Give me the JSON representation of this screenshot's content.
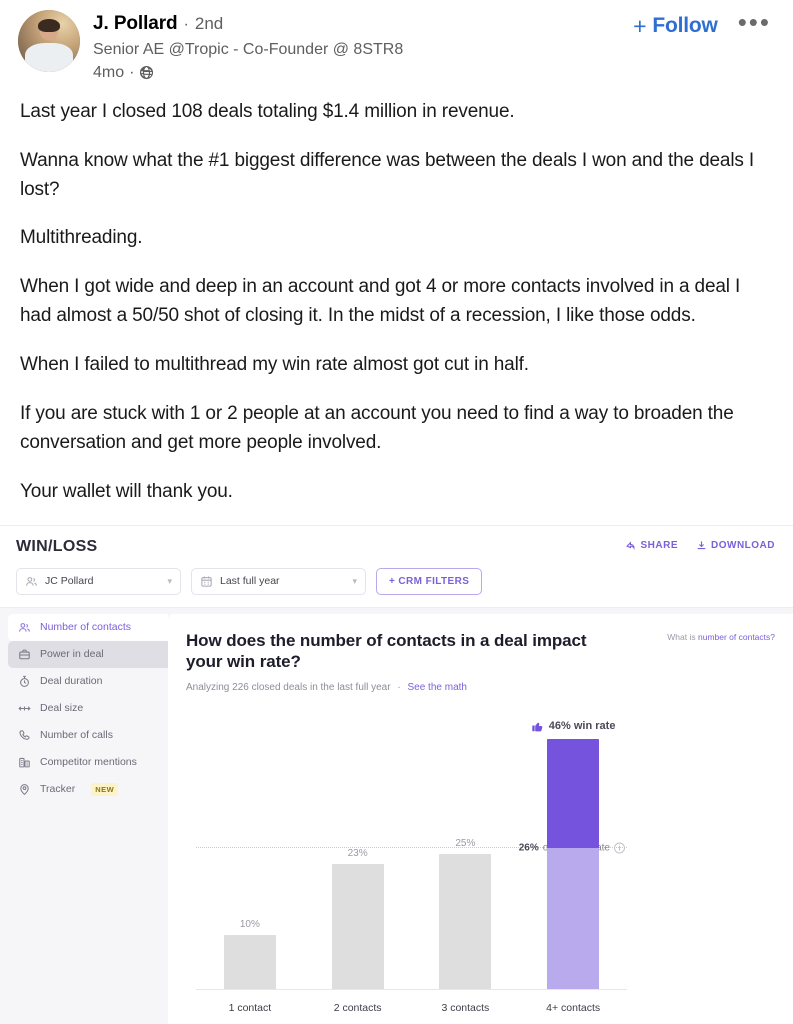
{
  "post": {
    "author_name": "J. Pollard",
    "separator": "·",
    "degree": "2nd",
    "headline": "Senior AE @Tropic - Co-Founder @ 8STR8",
    "timestamp": "4mo",
    "visibility_icon": "globe-icon",
    "follow_label": "Follow",
    "follow_plus": "+",
    "more_label": "•••",
    "paragraphs": [
      "Last year I closed 108 deals totaling $1.4 million in revenue.",
      "Wanna know what the #1 biggest difference was between the deals I won and the deals I lost?",
      "Multithreading.",
      "When I got wide and deep in an account and got 4 or more contacts involved in a deal I had almost a 50/50 shot of closing it. In the midst of a recession, I like those odds.",
      "When I failed to multithread my win rate almost got cut in half.",
      "If you are stuck with 1 or 2 people at an account you need to find a way to broaden the conversation and get more people involved.",
      "Your wallet will thank you."
    ]
  },
  "dashboard": {
    "title": "WIN/LOSS",
    "share_label": "SHARE",
    "download_label": "DOWNLOAD",
    "filters": {
      "person": "JC Pollard",
      "date_range": "Last full year",
      "crm_button": "+ CRM FILTERS"
    },
    "sidebar": {
      "items": [
        {
          "label": "Number of contacts",
          "icon": "people-icon",
          "state": "active"
        },
        {
          "label": "Power in deal",
          "icon": "briefcase-icon",
          "state": "hover"
        },
        {
          "label": "Deal duration",
          "icon": "stopwatch-icon",
          "state": "default"
        },
        {
          "label": "Deal size",
          "icon": "arrows-horizontal-icon",
          "state": "default"
        },
        {
          "label": "Number of calls",
          "icon": "phone-icon",
          "state": "default"
        },
        {
          "label": "Competitor mentions",
          "icon": "buildings-icon",
          "state": "default"
        },
        {
          "label": "Tracker",
          "icon": "location-pin-icon",
          "state": "default",
          "badge": "NEW"
        }
      ]
    },
    "chart_header": {
      "question": "How does the number of contacts in a deal impact your win rate?",
      "subtext": "Analyzing 226 closed deals in the last full year",
      "separator": "·",
      "see_math": "See the math",
      "what_is_prefix": "What is ",
      "what_is_link": "number of contacts?"
    },
    "colors": {
      "accent_purple": "#7553dd",
      "light_purple": "#b9aaee",
      "bar_gray": "#dededf",
      "link_blue": "#2f6fd0",
      "badge_yellow": "#fdf3c8"
    }
  },
  "chart_data": {
    "type": "bar",
    "title": "How does the number of contacts in a deal impact your win rate?",
    "subtitle": "Analyzing 226 closed deals in the last full year",
    "xlabel": "",
    "ylabel": "Win rate",
    "ylim": [
      0,
      50
    ],
    "grid": false,
    "legend": false,
    "categories": [
      "1 contact",
      "2 contacts",
      "3 contacts",
      "4+ contacts"
    ],
    "values": [
      10,
      23,
      25,
      46
    ],
    "value_labels": [
      "10%",
      "23%",
      "25%",
      "46%"
    ],
    "highlight_index": 3,
    "highlight_badge": "46% win rate",
    "highlight_icon": "thumbs-up-icon",
    "reference_line": {
      "value": 26,
      "label_value": "26%",
      "label_text": "overall win rate",
      "style": "dotted"
    },
    "bar_colors": [
      "#dededf",
      "#dededf",
      "#dededf",
      "#b9aaee"
    ],
    "highlight_over_reference_color": "#7553dd"
  }
}
